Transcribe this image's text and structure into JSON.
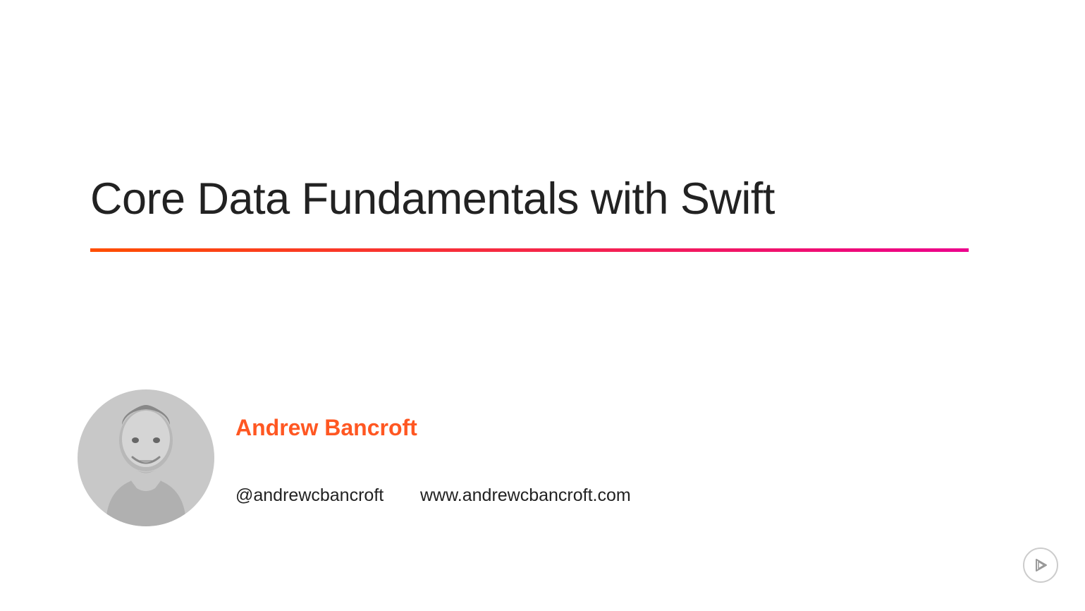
{
  "slide": {
    "title": "Core Data Fundamentals with Swift"
  },
  "author": {
    "name": "Andrew Bancroft",
    "handle": "@andrewcbancroft",
    "website": "www.andrewcbancroft.com"
  },
  "colors": {
    "gradient_start": "#ff4e00",
    "gradient_end": "#ec008c",
    "accent": "#ff5722",
    "text": "#222222"
  }
}
